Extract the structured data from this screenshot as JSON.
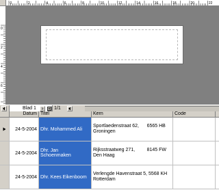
{
  "rulers": {
    "h_ticks": [
      "0",
      "1",
      "2",
      "3",
      "4",
      "5",
      "6",
      "7",
      "8",
      "9",
      "10",
      "11",
      "12",
      "13",
      "14",
      "15",
      "16",
      "17",
      "18",
      "19",
      "20",
      "21",
      "22"
    ],
    "v_ticks": [
      "0",
      "1",
      "2",
      "3",
      "4",
      "5",
      "6",
      "7",
      "8",
      "9"
    ]
  },
  "sheet": {
    "tab_label": "Blad 1",
    "page_indicator": "1/1"
  },
  "grid": {
    "columns": [
      "Datum",
      "Titel",
      "Kern",
      "Code"
    ],
    "rows": [
      {
        "datum": "24-5-2004",
        "titel": "Dhr. Mohammed Ali",
        "kern": "Sportlaedenstraat 62,      6565 HB Groningen",
        "code": "",
        "current": true
      },
      {
        "datum": "24-5-2004",
        "titel": "Dhr. Jan Schoenmaken",
        "kern": "Rijksstraatweg 271,         8145 FW Den Haag",
        "code": "",
        "current": false
      },
      {
        "datum": "24-5-2004",
        "titel": "Dhr. Kees Eikenboom",
        "kern": "Verlengde Havenstraat 5, 5568 KH Rotterdam",
        "code": "",
        "current": false
      }
    ]
  },
  "colors": {
    "selection": "#316ac5",
    "canvas": "#808080",
    "chrome": "#d4d0c8"
  }
}
